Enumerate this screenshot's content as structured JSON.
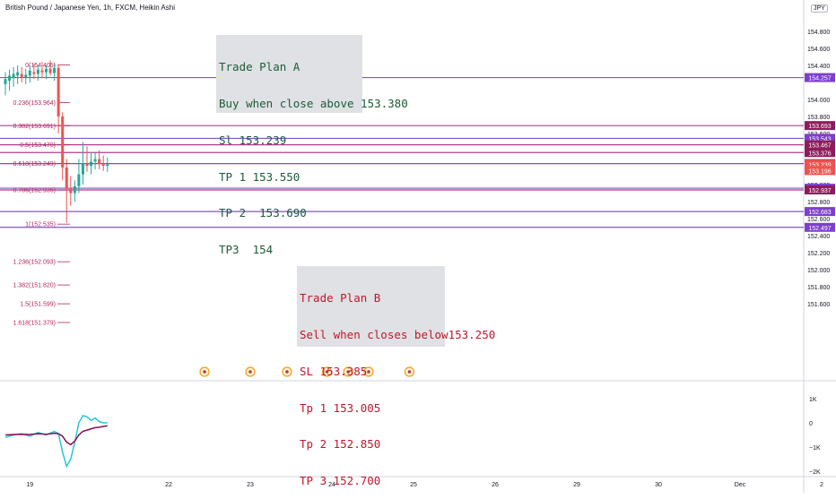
{
  "header": {
    "symbol_title": "British Pound / Japanese Yen, 1h, FXCM, Heikin Ashi",
    "currency_badge": "JPY"
  },
  "colors": {
    "up": "#26a69a",
    "down": "#ef5350",
    "purple_line": "#7e57c2",
    "magenta_line": "#b03b8f",
    "fib_text": "#b2275f",
    "osc_fast": "#26c6da",
    "osc_slow": "#880e4f",
    "note_bg": "#dfe1e4",
    "note_a_text": "#1d5b38",
    "note_b_text": "#c0182c",
    "marker": "#f39c12"
  },
  "notes": {
    "plan_a": [
      "Trade Plan A",
      "Buy when close above 153.380",
      "Sl 153.239",
      "TP 1 153.550",
      "TP 2  153.690",
      "TP3  154"
    ],
    "plan_b": [
      "Trade Plan B",
      "Sell when closes below153.250",
      "SL 153.385",
      "Tp 1 153.005",
      "Tp 2 152.850",
      "TP 3 152.700"
    ]
  },
  "chart_data": [
    {
      "type": "candlestick",
      "style": "heikin ashi",
      "title": "British Pound / Japanese Yen, 1h, FXCM, Heikin Ashi",
      "ylim": [
        151.2,
        154.95
      ],
      "y_ticks": [
        "154.800",
        "154.600",
        "154.400",
        "154.000",
        "153.800",
        "153.600",
        "153.000",
        "152.800",
        "152.600",
        "152.400",
        "152.200",
        "152.000",
        "151.800",
        "151.600"
      ],
      "x_ticks": [
        "19",
        "22",
        "23",
        "24",
        "25",
        "26",
        "29",
        "30",
        "Dec",
        "2"
      ],
      "x_tick_positions": [
        0,
        2,
        3,
        4,
        5,
        6,
        7,
        8,
        9,
        10
      ],
      "candles": [
        {
          "t": 0.0,
          "o": 154.18,
          "h": 154.32,
          "l": 154.05,
          "c": 154.24
        },
        {
          "t": 0.05,
          "o": 154.22,
          "h": 154.35,
          "l": 154.1,
          "c": 154.28
        },
        {
          "t": 0.1,
          "o": 154.25,
          "h": 154.38,
          "l": 154.15,
          "c": 154.3
        },
        {
          "t": 0.15,
          "o": 154.28,
          "h": 154.4,
          "l": 154.18,
          "c": 154.32
        },
        {
          "t": 0.2,
          "o": 154.3,
          "h": 154.38,
          "l": 154.2,
          "c": 154.26
        },
        {
          "t": 0.25,
          "o": 154.26,
          "h": 154.36,
          "l": 154.18,
          "c": 154.29
        },
        {
          "t": 0.3,
          "o": 154.28,
          "h": 154.4,
          "l": 154.2,
          "c": 154.34
        },
        {
          "t": 0.35,
          "o": 154.32,
          "h": 154.42,
          "l": 154.24,
          "c": 154.3
        },
        {
          "t": 0.4,
          "o": 154.3,
          "h": 154.4,
          "l": 154.22,
          "c": 154.35
        },
        {
          "t": 0.45,
          "o": 154.34,
          "h": 154.44,
          "l": 154.26,
          "c": 154.32
        },
        {
          "t": 0.5,
          "o": 154.32,
          "h": 154.4,
          "l": 154.24,
          "c": 154.36
        },
        {
          "t": 0.55,
          "o": 154.36,
          "h": 154.46,
          "l": 154.28,
          "c": 154.31
        },
        {
          "t": 0.6,
          "o": 154.31,
          "h": 154.42,
          "l": 154.22,
          "c": 154.37
        },
        {
          "t": 0.65,
          "o": 154.37,
          "h": 154.41,
          "l": 153.6,
          "c": 153.8
        },
        {
          "t": 0.7,
          "o": 153.8,
          "h": 153.85,
          "l": 153.05,
          "c": 153.2
        },
        {
          "t": 0.75,
          "o": 153.2,
          "h": 153.3,
          "l": 152.55,
          "c": 152.95
        },
        {
          "t": 0.8,
          "o": 152.95,
          "h": 153.1,
          "l": 152.75,
          "c": 152.9
        },
        {
          "t": 0.85,
          "o": 152.9,
          "h": 153.05,
          "l": 152.8,
          "c": 152.98
        },
        {
          "t": 0.9,
          "o": 152.98,
          "h": 153.3,
          "l": 152.9,
          "c": 153.12
        },
        {
          "t": 0.95,
          "o": 153.12,
          "h": 153.5,
          "l": 153.0,
          "c": 153.25
        },
        {
          "t": 1.0,
          "o": 153.25,
          "h": 153.45,
          "l": 153.15,
          "c": 153.22
        },
        {
          "t": 1.05,
          "o": 153.22,
          "h": 153.38,
          "l": 153.12,
          "c": 153.27
        },
        {
          "t": 1.1,
          "o": 153.27,
          "h": 153.38,
          "l": 153.18,
          "c": 153.3
        },
        {
          "t": 1.15,
          "o": 153.3,
          "h": 153.4,
          "l": 153.18,
          "c": 153.24
        },
        {
          "t": 1.2,
          "o": 153.24,
          "h": 153.34,
          "l": 153.16,
          "c": 153.22
        },
        {
          "t": 1.25,
          "o": 153.22,
          "h": 153.32,
          "l": 153.15,
          "c": 153.24
        }
      ],
      "fib_levels": [
        {
          "label": "0(154.405)",
          "value": 154.405
        },
        {
          "label": "0.236(153.964)",
          "value": 153.964
        },
        {
          "label": "0.382(153.691)",
          "value": 153.691
        },
        {
          "label": "0.5(153.470)",
          "value": 153.47
        },
        {
          "label": "0.618(153.249)",
          "value": 153.249
        },
        {
          "label": "0.786(152.935)",
          "value": 152.935
        },
        {
          "label": "1(152.535)",
          "value": 152.535
        },
        {
          "label": "1.236(152.093)",
          "value": 152.093
        },
        {
          "label": "1.382(151.820)",
          "value": 151.82
        },
        {
          "label": "1.5(151.599)",
          "value": 151.599
        },
        {
          "label": "1.618(151.379)",
          "value": 151.379
        }
      ],
      "horizontal_lines": [
        {
          "value": 154.257,
          "label": "154.257",
          "color": "purple"
        },
        {
          "value": 153.693,
          "label": "153.693",
          "color": "magenta"
        },
        {
          "value": 153.543,
          "label": "153.543",
          "color": "purple"
        },
        {
          "value": 153.467,
          "label": "153.467",
          "color": "magenta"
        },
        {
          "value": 153.376,
          "label": "153.376",
          "color": "magenta"
        },
        {
          "value": 153.246,
          "label": "153.246",
          "color": "magenta"
        },
        {
          "value": 152.957,
          "label": "152.957",
          "color": "purple"
        },
        {
          "value": 152.937,
          "label": "152.937",
          "color": "magenta"
        },
        {
          "value": 152.683,
          "label": "152.683",
          "color": "purple"
        },
        {
          "value": 152.497,
          "label": "152.497",
          "color": "purple"
        }
      ],
      "price_badges": [
        {
          "value": 153.239,
          "label": "153.239",
          "color": "red"
        },
        {
          "value": 153.196,
          "label": "153.196",
          "color": "red"
        }
      ],
      "event_markers": [
        2.44,
        3.0,
        3.45,
        3.94,
        4.2,
        4.45,
        4.95
      ]
    },
    {
      "type": "line",
      "title": "",
      "ylim": [
        -2000,
        1500
      ],
      "y_ticks": [
        "1K",
        "0",
        "−1K",
        "−2K"
      ],
      "y_tick_values": [
        1000,
        0,
        -1000,
        -2000
      ],
      "series": [
        {
          "color": "osc_fast",
          "x": [
            0.0,
            0.1,
            0.2,
            0.3,
            0.4,
            0.5,
            0.6,
            0.65,
            0.7,
            0.75,
            0.8,
            0.85,
            0.9,
            0.95,
            1.0,
            1.05,
            1.1,
            1.15,
            1.2,
            1.25
          ],
          "values": [
            -600,
            -500,
            -450,
            -550,
            -400,
            -500,
            -350,
            -450,
            -1200,
            -1800,
            -1500,
            -800,
            0,
            300,
            250,
            100,
            200,
            50,
            0,
            0
          ]
        },
        {
          "color": "osc_slow",
          "x": [
            0.0,
            0.1,
            0.2,
            0.3,
            0.4,
            0.5,
            0.6,
            0.65,
            0.7,
            0.75,
            0.8,
            0.85,
            0.9,
            0.95,
            1.0,
            1.05,
            1.1,
            1.15,
            1.2,
            1.25
          ],
          "values": [
            -500,
            -480,
            -470,
            -480,
            -450,
            -470,
            -430,
            -450,
            -550,
            -800,
            -900,
            -750,
            -500,
            -350,
            -300,
            -250,
            -200,
            -180,
            -150,
            -120
          ]
        }
      ]
    }
  ]
}
